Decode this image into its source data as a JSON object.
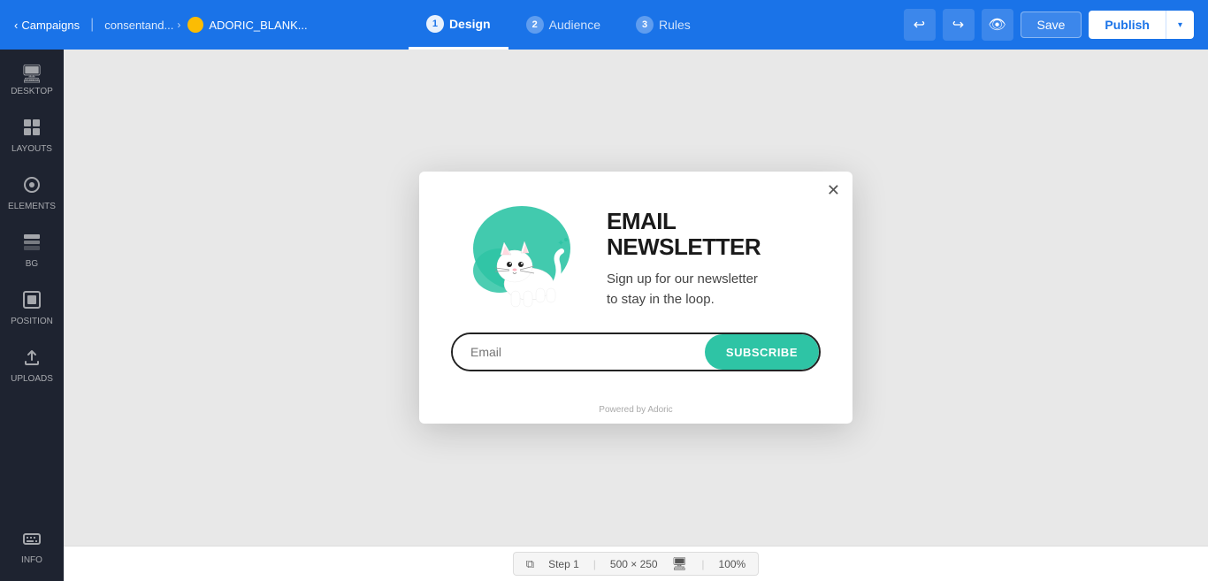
{
  "topnav": {
    "back_label": "Campaigns",
    "breadcrumb_label": "consentand...",
    "current_label": "ADORIC_BLANK...",
    "steps": [
      {
        "num": "1",
        "label": "Design",
        "active": true
      },
      {
        "num": "2",
        "label": "Audience",
        "active": false
      },
      {
        "num": "3",
        "label": "Rules",
        "active": false
      }
    ],
    "save_label": "Save",
    "publish_label": "Publish"
  },
  "sidebar": {
    "items": [
      {
        "id": "desktop",
        "icon": "🖥",
        "label": "DESKTOP"
      },
      {
        "id": "layouts",
        "icon": "⊞",
        "label": "LAYOUTS"
      },
      {
        "id": "elements",
        "icon": "◎",
        "label": "ELEMENTS"
      },
      {
        "id": "bg",
        "icon": "▤",
        "label": "BG"
      },
      {
        "id": "position",
        "icon": "⊡",
        "label": "POSITION"
      },
      {
        "id": "uploads",
        "icon": "↑",
        "label": "UPLOADS"
      },
      {
        "id": "info",
        "icon": "⌨",
        "label": "INFO"
      }
    ]
  },
  "popup": {
    "title": "EMAIL NEWSLETTER",
    "subtitle": "Sign up for our newsletter\nto stay in the loop.",
    "email_placeholder": "Email",
    "subscribe_label": "SUBSCRIBE",
    "powered_label": "Powered by Adoric"
  },
  "bottom_bar": {
    "step_label": "Step 1",
    "dimensions": "500 × 250",
    "zoom": "100%"
  }
}
